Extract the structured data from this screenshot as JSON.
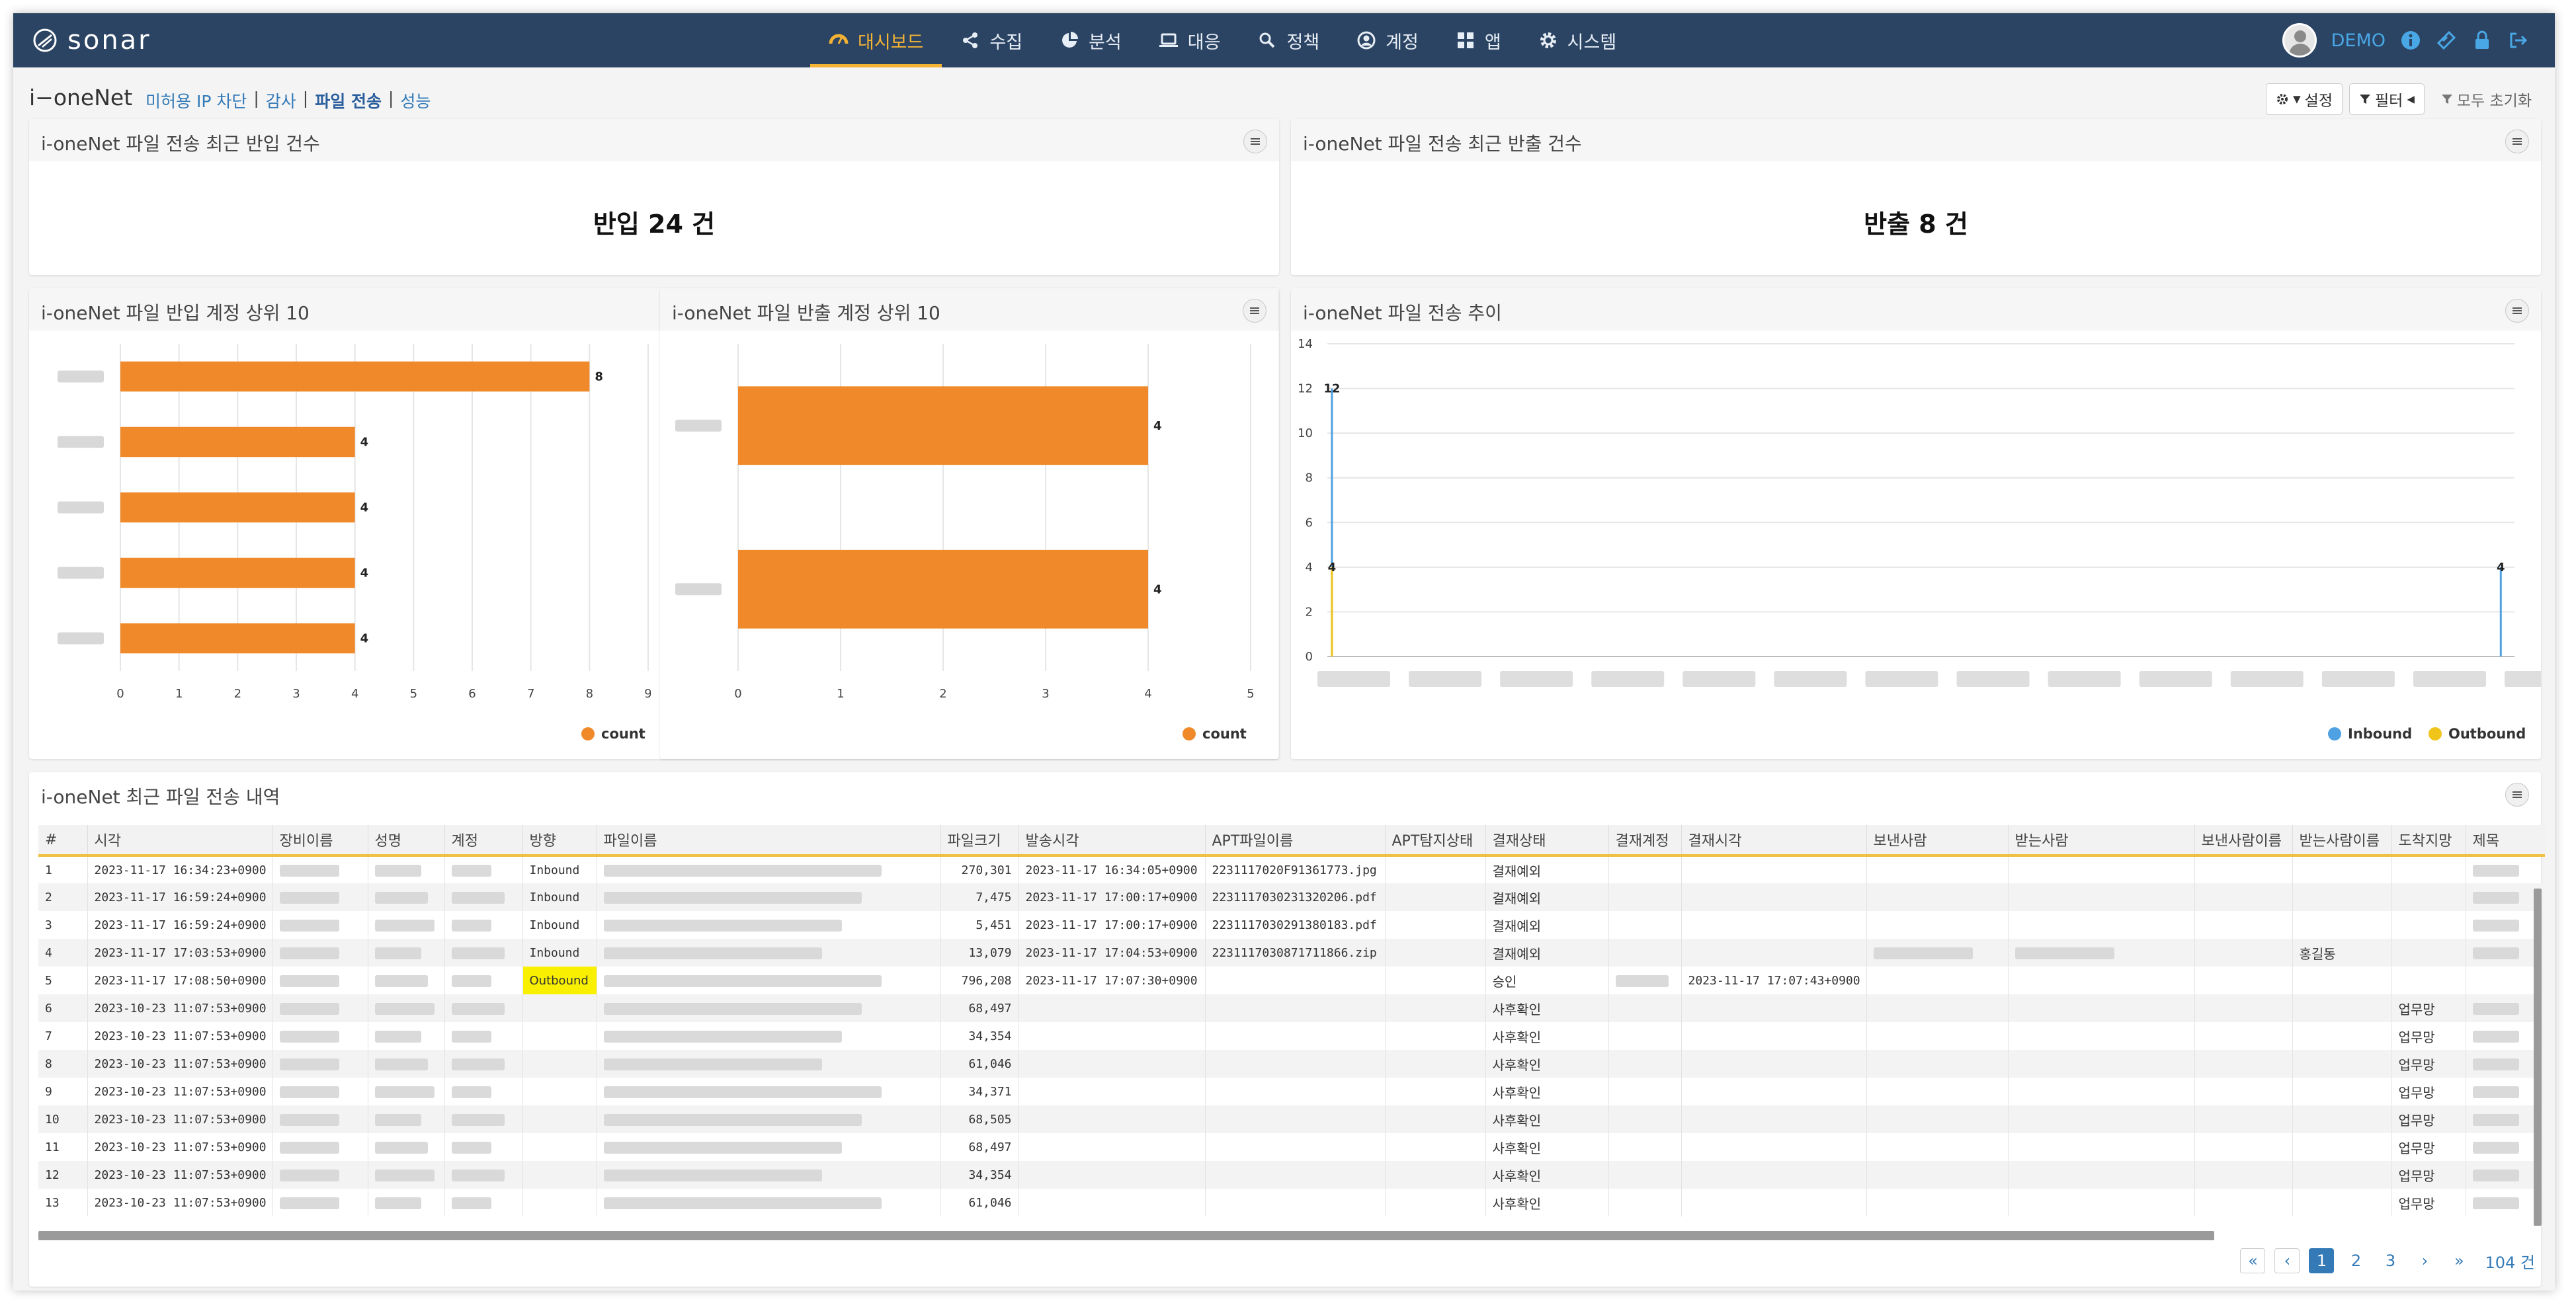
{
  "nav": {
    "logo": "sonar",
    "items": [
      {
        "label": "대시보드",
        "icon": "dashboard-icon",
        "active": true
      },
      {
        "label": "수집",
        "icon": "share-icon"
      },
      {
        "label": "분석",
        "icon": "pie-chart-icon"
      },
      {
        "label": "대응",
        "icon": "laptop-icon"
      },
      {
        "label": "정책",
        "icon": "search-icon"
      },
      {
        "label": "계정",
        "icon": "user-circle-icon"
      },
      {
        "label": "앱",
        "icon": "grid-icon"
      },
      {
        "label": "시스템",
        "icon": "gear-icon"
      }
    ],
    "user": "DEMO"
  },
  "page": {
    "title": "i−oneNet",
    "breadcrumb": [
      "미허용 IP 차단",
      "감사",
      "파일 전송",
      "성능"
    ],
    "tools": {
      "settings": "설정",
      "filter": "필터",
      "reset": "모두 초기화"
    }
  },
  "panels": {
    "inbound_count": {
      "title": "i-oneNet 파일 전송 최근 반입 건수",
      "value": "반입 24 건"
    },
    "outbound_count": {
      "title": "i-oneNet 파일 전송 최근 반출 건수",
      "value": "반출 8 건"
    },
    "inbound_top": {
      "title": "i-oneNet 파일 반입 계정 상위 10"
    },
    "outbound_top": {
      "title": "i-oneNet 파일 반출 계정 상위 10"
    },
    "trend": {
      "title": "i-oneNet 파일 전송 추이"
    },
    "recent": {
      "title": "i-oneNet 최근 파일 전송 내역"
    }
  },
  "chart_data": [
    {
      "type": "bar",
      "orientation": "horizontal",
      "categories": [
        "",
        "",
        "",
        "",
        ""
      ],
      "series": [
        {
          "name": "count",
          "values": [
            8,
            4,
            4,
            4,
            4
          ]
        }
      ],
      "xlim": [
        0,
        9
      ],
      "xticks": [
        0,
        1,
        2,
        3,
        4,
        5,
        6,
        7,
        8,
        9
      ],
      "color": "#f0892a",
      "legend": "bottom-right"
    },
    {
      "type": "bar",
      "orientation": "horizontal",
      "categories": [
        "",
        ""
      ],
      "series": [
        {
          "name": "count",
          "values": [
            4,
            4
          ]
        }
      ],
      "xlim": [
        0,
        5
      ],
      "xticks": [
        0,
        1,
        2,
        3,
        4,
        5
      ],
      "color": "#f0892a",
      "legend": "bottom-right"
    },
    {
      "type": "line",
      "x_index": [
        0,
        1,
        2,
        3,
        4,
        5,
        6,
        7,
        8,
        9,
        10,
        11,
        12,
        13
      ],
      "series": [
        {
          "name": "Inbound",
          "color": "#4ea1e3",
          "points": [
            {
              "x": 0.05,
              "y": 12,
              "label": "12"
            },
            {
              "x": 12.85,
              "y": 4,
              "label": "4"
            }
          ]
        },
        {
          "name": "Outbound",
          "color": "#f0c419",
          "points": [
            {
              "x": 0.05,
              "y": 4,
              "label": "4"
            },
            {
              "x": 13.45,
              "y": 4,
              "label": "4"
            }
          ]
        }
      ],
      "ylim": [
        0,
        14
      ],
      "yticks": [
        0,
        2,
        4,
        6,
        8,
        10,
        12,
        14
      ],
      "legend": "bottom-right"
    }
  ],
  "table": {
    "columns": [
      "#",
      "시각",
      "장비이름",
      "성명",
      "계정",
      "방향",
      "파일이름",
      "파일크기",
      "발송시각",
      "APT파일이름",
      "APT탐지상태",
      "결재상태",
      "결재계정",
      "결재시각",
      "보낸사람",
      "받는사람",
      "보낸사람이름",
      "받는사람이름",
      "도착지망",
      "제목"
    ],
    "rows": [
      {
        "no": "1",
        "time": "2023-11-17 16:34:23+0900",
        "dir": "Inbound",
        "size": "270,301",
        "sent": "2023-11-17 16:34:05+0900",
        "apt": "2231117020F91361773.jpg",
        "status": "결재예외",
        "appr_time": "",
        "recv_name": "",
        "dest": ""
      },
      {
        "no": "2",
        "time": "2023-11-17 16:59:24+0900",
        "dir": "Inbound",
        "size": "7,475",
        "sent": "2023-11-17 17:00:17+0900",
        "apt": "2231117030231320206.pdf",
        "status": "결재예외",
        "appr_time": "",
        "recv_name": "",
        "dest": ""
      },
      {
        "no": "3",
        "time": "2023-11-17 16:59:24+0900",
        "dir": "Inbound",
        "size": "5,451",
        "sent": "2023-11-17 17:00:17+0900",
        "apt": "2231117030291380183.pdf",
        "status": "결재예외",
        "appr_time": "",
        "recv_name": "",
        "dest": ""
      },
      {
        "no": "4",
        "time": "2023-11-17 17:03:53+0900",
        "dir": "Inbound",
        "size": "13,079",
        "sent": "2023-11-17 17:04:53+0900",
        "apt": "2231117030871711866.zip",
        "status": "결재예외",
        "appr_time": "",
        "recv_name": "홍길동",
        "dest": ""
      },
      {
        "no": "5",
        "time": "2023-11-17 17:08:50+0900",
        "dir": "Outbound",
        "size": "796,208",
        "sent": "2023-11-17 17:07:30+0900",
        "apt": "",
        "status": "승인",
        "appr_time": "2023-11-17 17:07:43+0900",
        "recv_name": "",
        "dest": ""
      },
      {
        "no": "6",
        "time": "2023-10-23 11:07:53+0900",
        "dir": "",
        "size": "68,497",
        "sent": "",
        "apt": "",
        "status": "사후확인",
        "appr_time": "",
        "recv_name": "",
        "dest": "업무망"
      },
      {
        "no": "7",
        "time": "2023-10-23 11:07:53+0900",
        "dir": "",
        "size": "34,354",
        "sent": "",
        "apt": "",
        "status": "사후확인",
        "appr_time": "",
        "recv_name": "",
        "dest": "업무망"
      },
      {
        "no": "8",
        "time": "2023-10-23 11:07:53+0900",
        "dir": "",
        "size": "61,046",
        "sent": "",
        "apt": "",
        "status": "사후확인",
        "appr_time": "",
        "recv_name": "",
        "dest": "업무망"
      },
      {
        "no": "9",
        "time": "2023-10-23 11:07:53+0900",
        "dir": "",
        "size": "34,371",
        "sent": "",
        "apt": "",
        "status": "사후확인",
        "appr_time": "",
        "recv_name": "",
        "dest": "업무망"
      },
      {
        "no": "10",
        "time": "2023-10-23 11:07:53+0900",
        "dir": "",
        "size": "68,505",
        "sent": "",
        "apt": "",
        "status": "사후확인",
        "appr_time": "",
        "recv_name": "",
        "dest": "업무망"
      },
      {
        "no": "11",
        "time": "2023-10-23 11:07:53+0900",
        "dir": "",
        "size": "68,497",
        "sent": "",
        "apt": "",
        "status": "사후확인",
        "appr_time": "",
        "recv_name": "",
        "dest": "업무망"
      },
      {
        "no": "12",
        "time": "2023-10-23 11:07:53+0900",
        "dir": "",
        "size": "34,354",
        "sent": "",
        "apt": "",
        "status": "사후확인",
        "appr_time": "",
        "recv_name": "",
        "dest": "업무망"
      },
      {
        "no": "13",
        "time": "2023-10-23 11:07:53+0900",
        "dir": "",
        "size": "61,046",
        "sent": "",
        "apt": "",
        "status": "사후확인",
        "appr_time": "",
        "recv_name": "",
        "dest": "업무망"
      }
    ]
  },
  "pagination": {
    "first": "«",
    "prev": "‹",
    "pages": [
      "1",
      "2",
      "3"
    ],
    "current": "1",
    "next": "›",
    "last": "»",
    "total": "104 건"
  },
  "colors": {
    "nav_bg": "#2b4463",
    "accent": "#f5b334",
    "bar": "#f0892a",
    "inbound": "#4ea1e3",
    "outbound": "#f0c419",
    "link": "#337ab7"
  }
}
